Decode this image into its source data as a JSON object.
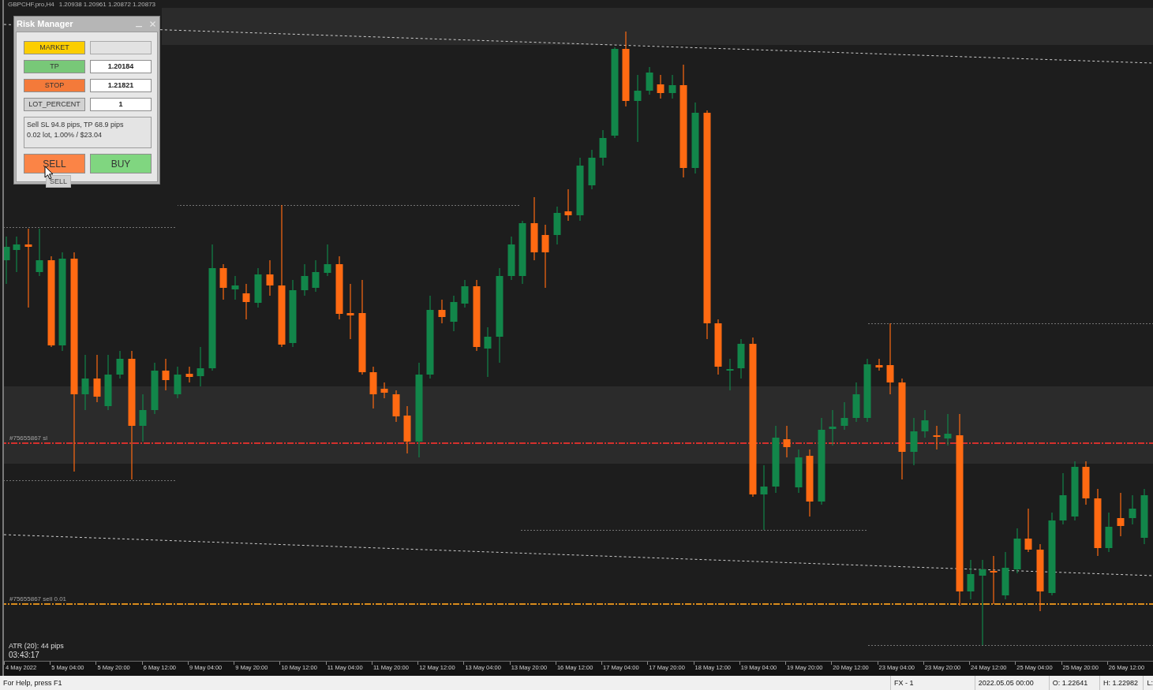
{
  "chart": {
    "symbol": "GBPCHF.pro,H4",
    "quotes": "1.20938 1.20961 1.20872 1.20873",
    "order_lines": [
      {
        "label": "#75655867 sl",
        "color": "#d3302c"
      },
      {
        "label": "#75655867 sell 0.01",
        "color": "#d98b1c"
      }
    ],
    "indicator": {
      "atr": "ATR (20): 44 pips",
      "countdown": "03:43:17"
    },
    "time_axis": [
      "4 May 2022",
      "5 May 04:00",
      "5 May 20:00",
      "6 May 12:00",
      "9 May 04:00",
      "9 May 20:00",
      "10 May 12:00",
      "11 May 04:00",
      "11 May 20:00",
      "12 May 12:00",
      "13 May 04:00",
      "13 May 20:00",
      "16 May 12:00",
      "17 May 04:00",
      "17 May 20:00",
      "18 May 12:00",
      "19 May 04:00",
      "19 May 20:00",
      "20 May 12:00",
      "23 May 04:00",
      "23 May 20:00",
      "24 May 12:00",
      "25 May 04:00",
      "25 May 20:00",
      "26 May 12:00"
    ]
  },
  "risk_manager": {
    "title": "Risk Manager",
    "rows": [
      {
        "label": "MARKET",
        "color": "#fcce00",
        "field": {
          "disabled": true
        }
      },
      {
        "label": "TP",
        "color": "#78c878",
        "field": {
          "value": "1.20184",
          "disabled": false
        }
      },
      {
        "label": "STOP",
        "color": "#f47a3a",
        "field": {
          "value": "1.21821",
          "disabled": false
        }
      },
      {
        "label": "LOT_PERCENT",
        "color": "#d2d2d2",
        "field": {
          "value": "1",
          "disabled": false
        }
      }
    ],
    "summary": [
      "Sell SL 94.8 pips, TP 68.9 pips",
      "0.02 lot, 1.00% / $23.04"
    ],
    "actions": [
      {
        "label": "SELL",
        "color": "#fb8446"
      },
      {
        "label": "BUY",
        "color": "#80d680"
      }
    ],
    "tooltip": "SELL"
  },
  "status_bar": {
    "help": "For Help, press F1",
    "panes": [
      "FX - 1",
      "2022.05.05 00:00",
      "O: 1.22641",
      "H: 1.22982",
      "L:"
    ]
  }
}
